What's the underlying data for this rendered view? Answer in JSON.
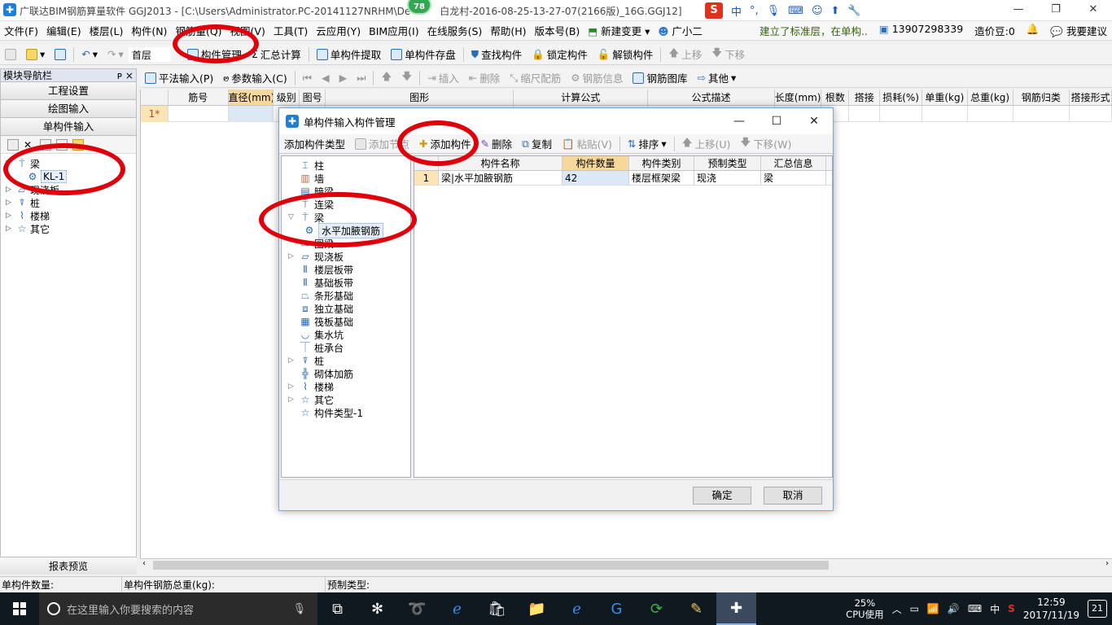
{
  "window": {
    "title": "广联达BIM钢筋算量软件 GGJ2013 - [C:\\Users\\Administrator.PC-20141127NRHM\\De",
    "title_tail": "白龙村-2016-08-25-13-27-07(2166版)_16G.GGJ12]",
    "badge": "78"
  },
  "ime": {
    "lang": "中",
    "punct": "°,"
  },
  "menu": {
    "items": [
      "文件(F)",
      "编辑(E)",
      "楼层(L)",
      "构件(N)",
      "钢筋量(Q)",
      "视图(V)",
      "工具(T)",
      "云应用(Y)",
      "BIM应用(I)",
      "在线服务(S)",
      "帮助(H)",
      "版本号(B)",
      "新建变更",
      "广小二"
    ],
    "notice": "建立了标准层，在单构..",
    "phone": "13907298339",
    "cost": "造价豆:0",
    "suggest": "我要建议"
  },
  "toolbar1": {
    "floor": "首层",
    "component_manage": "构件管理",
    "summary": "汇总计算",
    "extract": "单构件提取",
    "save": "单构件存盘",
    "find": "查找构件",
    "lock": "锁定构件",
    "unlock": "解锁构件",
    "up": "上移",
    "down": "下移"
  },
  "nav": {
    "title": "模块导航栏",
    "pin": "ᴘ ×",
    "sections": [
      "工程设置",
      "绘图输入",
      "单构件输入"
    ],
    "footer": "报表预览"
  },
  "navtree": [
    {
      "label": "梁",
      "expanded": true
    },
    {
      "label": "KL-1",
      "child": true
    },
    {
      "label": "现浇板"
    },
    {
      "label": "桩"
    },
    {
      "label": "楼梯"
    },
    {
      "label": "其它"
    }
  ],
  "toolbar2": {
    "flat_input": "平法输入(P)",
    "param_input": "参数输入(C)",
    "insert": "插入",
    "delete": "删除",
    "scale": "缩尺配筋",
    "rebar_info": "钢筋信息",
    "rebar_lib": "钢筋图库",
    "other": "其他"
  },
  "grid": {
    "headers": [
      "筋号",
      "直径(mm)",
      "级别",
      "图号",
      "图形",
      "计算公式",
      "公式描述",
      "长度(mm)",
      "根数",
      "搭接",
      "损耗(%)",
      "单重(kg)",
      "总重(kg)",
      "钢筋归类",
      "搭接形式"
    ],
    "row1": "1*"
  },
  "status": {
    "count": "单构件数量:",
    "weight": "单构件钢筋总重(kg):",
    "pretype": "预制类型:"
  },
  "dialog": {
    "title": "单构件输入构件管理",
    "add_type": "添加构件类型",
    "add_node": "添加节点",
    "add_comp": "添加构件",
    "delete": "删除",
    "copy": "复制",
    "paste": "粘贴(V)",
    "sort": "排序",
    "up": "上移(U)",
    "down": "下移(W)",
    "ok": "确定",
    "cancel": "取消",
    "tree": [
      {
        "label": "柱"
      },
      {
        "label": "墙"
      },
      {
        "label": "暗梁"
      },
      {
        "label": "连梁"
      },
      {
        "label": "梁",
        "expanded": true
      },
      {
        "label": "水平加腋钢筋",
        "child": true
      },
      {
        "label": "圈梁"
      },
      {
        "label": "现浇板",
        "collapsed": true
      },
      {
        "label": "楼层板带"
      },
      {
        "label": "基础板带"
      },
      {
        "label": "条形基础"
      },
      {
        "label": "独立基础"
      },
      {
        "label": "筏板基础"
      },
      {
        "label": "集水坑"
      },
      {
        "label": "桩承台"
      },
      {
        "label": "桩",
        "collapsed": true
      },
      {
        "label": "砌体加筋"
      },
      {
        "label": "楼梯",
        "collapsed": true
      },
      {
        "label": "其它",
        "collapsed": true
      },
      {
        "label": "构件类型-1"
      }
    ],
    "table": {
      "headers": [
        "构件名称",
        "构件数量",
        "构件类别",
        "预制类型",
        "汇总信息"
      ],
      "rows": [
        {
          "no": "1",
          "name": "梁|水平加腋钢筋",
          "qty": "42",
          "category": "楼层框架梁",
          "pretype": "现浇",
          "summary": "梁"
        }
      ]
    }
  },
  "taskbar": {
    "search": "在这里输入你要搜索的内容",
    "cpu_pct": "25%",
    "cpu_label": "CPU使用",
    "ime": "中",
    "time": "12:59",
    "date": "2017/11/19",
    "notif": "21"
  }
}
